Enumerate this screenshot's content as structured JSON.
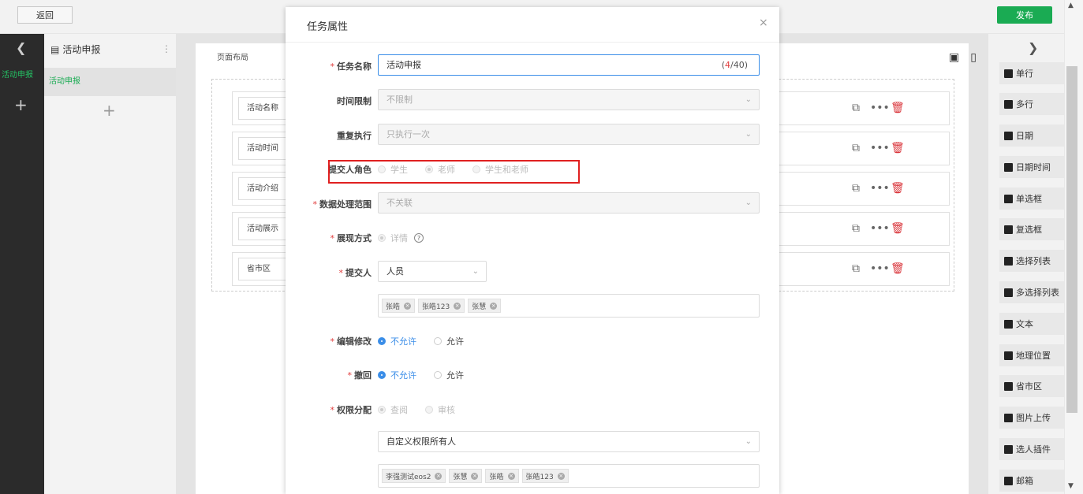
{
  "topbar": {
    "back_label": "返回",
    "publish_label": "发布",
    "publish_color": "#1aab53"
  },
  "leftnav": {
    "active_label": "活动申报"
  },
  "leftpanel": {
    "title": "活动申报",
    "item_label": "活动申报"
  },
  "canvas": {
    "layout_label": "页面布局",
    "fields": [
      "活动名称",
      "活动时间",
      "活动介绍",
      "活动展示",
      "省市区"
    ]
  },
  "components": [
    "单行",
    "多行",
    "日期",
    "日期时间",
    "单选框",
    "复选框",
    "选择列表",
    "多选择列表",
    "文本",
    "地理位置",
    "省市区",
    "图片上传",
    "选人插件",
    "邮箱"
  ],
  "modal": {
    "title": "任务属性",
    "close": "×",
    "task_name": {
      "label": "任务名称",
      "value": "活动申报",
      "count": "4",
      "max": "/40)",
      "count_open": "("
    },
    "time_limit": {
      "label": "时间限制",
      "value": "不限制"
    },
    "repeat": {
      "label": "重复执行",
      "value": "只执行一次"
    },
    "submitter_role": {
      "label": "提交人角色",
      "options": [
        "学生",
        "老师",
        "学生和老师"
      ]
    },
    "data_scope": {
      "label": "数据处理范围",
      "value": "不关联"
    },
    "display": {
      "label": "展现方式",
      "option": "详情",
      "help": "?"
    },
    "submitter": {
      "label": "提交人",
      "select": "人员",
      "tags": [
        "张皓",
        "张皓123",
        "张慧"
      ]
    },
    "edit": {
      "label": "编辑修改",
      "options": [
        "不允许",
        "允许"
      ]
    },
    "withdraw": {
      "label": "撤回",
      "options": [
        "不允许",
        "允许"
      ]
    },
    "permission": {
      "label": "权限分配",
      "options": [
        "查阅",
        "审核"
      ],
      "select": "自定义权限所有人",
      "tags": [
        "李强测试eos2",
        "张慧",
        "张皓",
        "张皓123"
      ]
    }
  },
  "colors": {
    "accent": "#3b8ee8",
    "required": "#e03c3c",
    "highlight": "#e02020"
  }
}
